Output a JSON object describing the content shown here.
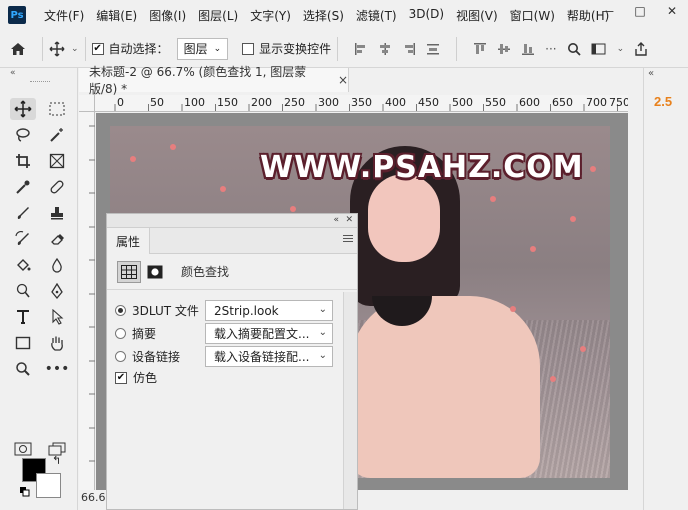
{
  "app": {
    "logo_text": "Ps"
  },
  "menu": [
    "文件(F)",
    "编辑(E)",
    "图像(I)",
    "图层(L)",
    "文字(Y)",
    "选择(S)",
    "滤镜(T)",
    "3D(D)",
    "视图(V)",
    "窗口(W)",
    "帮助(H)"
  ],
  "window_controls": {
    "minimize": "—",
    "restore": "□",
    "close": "✕"
  },
  "options": {
    "auto_select_label": "自动选择：",
    "auto_select_checked": true,
    "auto_select_value": "图层",
    "show_transform_label": "显示变换控件",
    "show_transform_checked": false
  },
  "document": {
    "tab_title": "未标题-2 @ 66.7% (颜色查找 1, 图层蒙版/8) *",
    "close": "×",
    "zoom_status": "66.67%"
  },
  "ruler": {
    "h_ticks": [
      "0",
      "50",
      "100",
      "150",
      "200",
      "250",
      "300",
      "350",
      "400",
      "450",
      "500",
      "550",
      "600",
      "650",
      "700",
      "750"
    ]
  },
  "canvas": {
    "watermark": "WWW.PSAHZ.COM"
  },
  "right_panel": {
    "value": "2.5"
  },
  "properties": {
    "tab_label": "属性",
    "title": "颜色查找",
    "rows": [
      {
        "label": "3DLUT 文件",
        "selected": true,
        "value": "2Strip.look"
      },
      {
        "label": "摘要",
        "selected": false,
        "value": "载入摘要配置文..."
      },
      {
        "label": "设备链接",
        "selected": false,
        "value": "载入设备链接配..."
      }
    ],
    "dither_label": "仿色",
    "dither_checked": true
  },
  "colors": {
    "accent": "#e8811c",
    "foreground": "#000000",
    "background": "#ffffff"
  }
}
